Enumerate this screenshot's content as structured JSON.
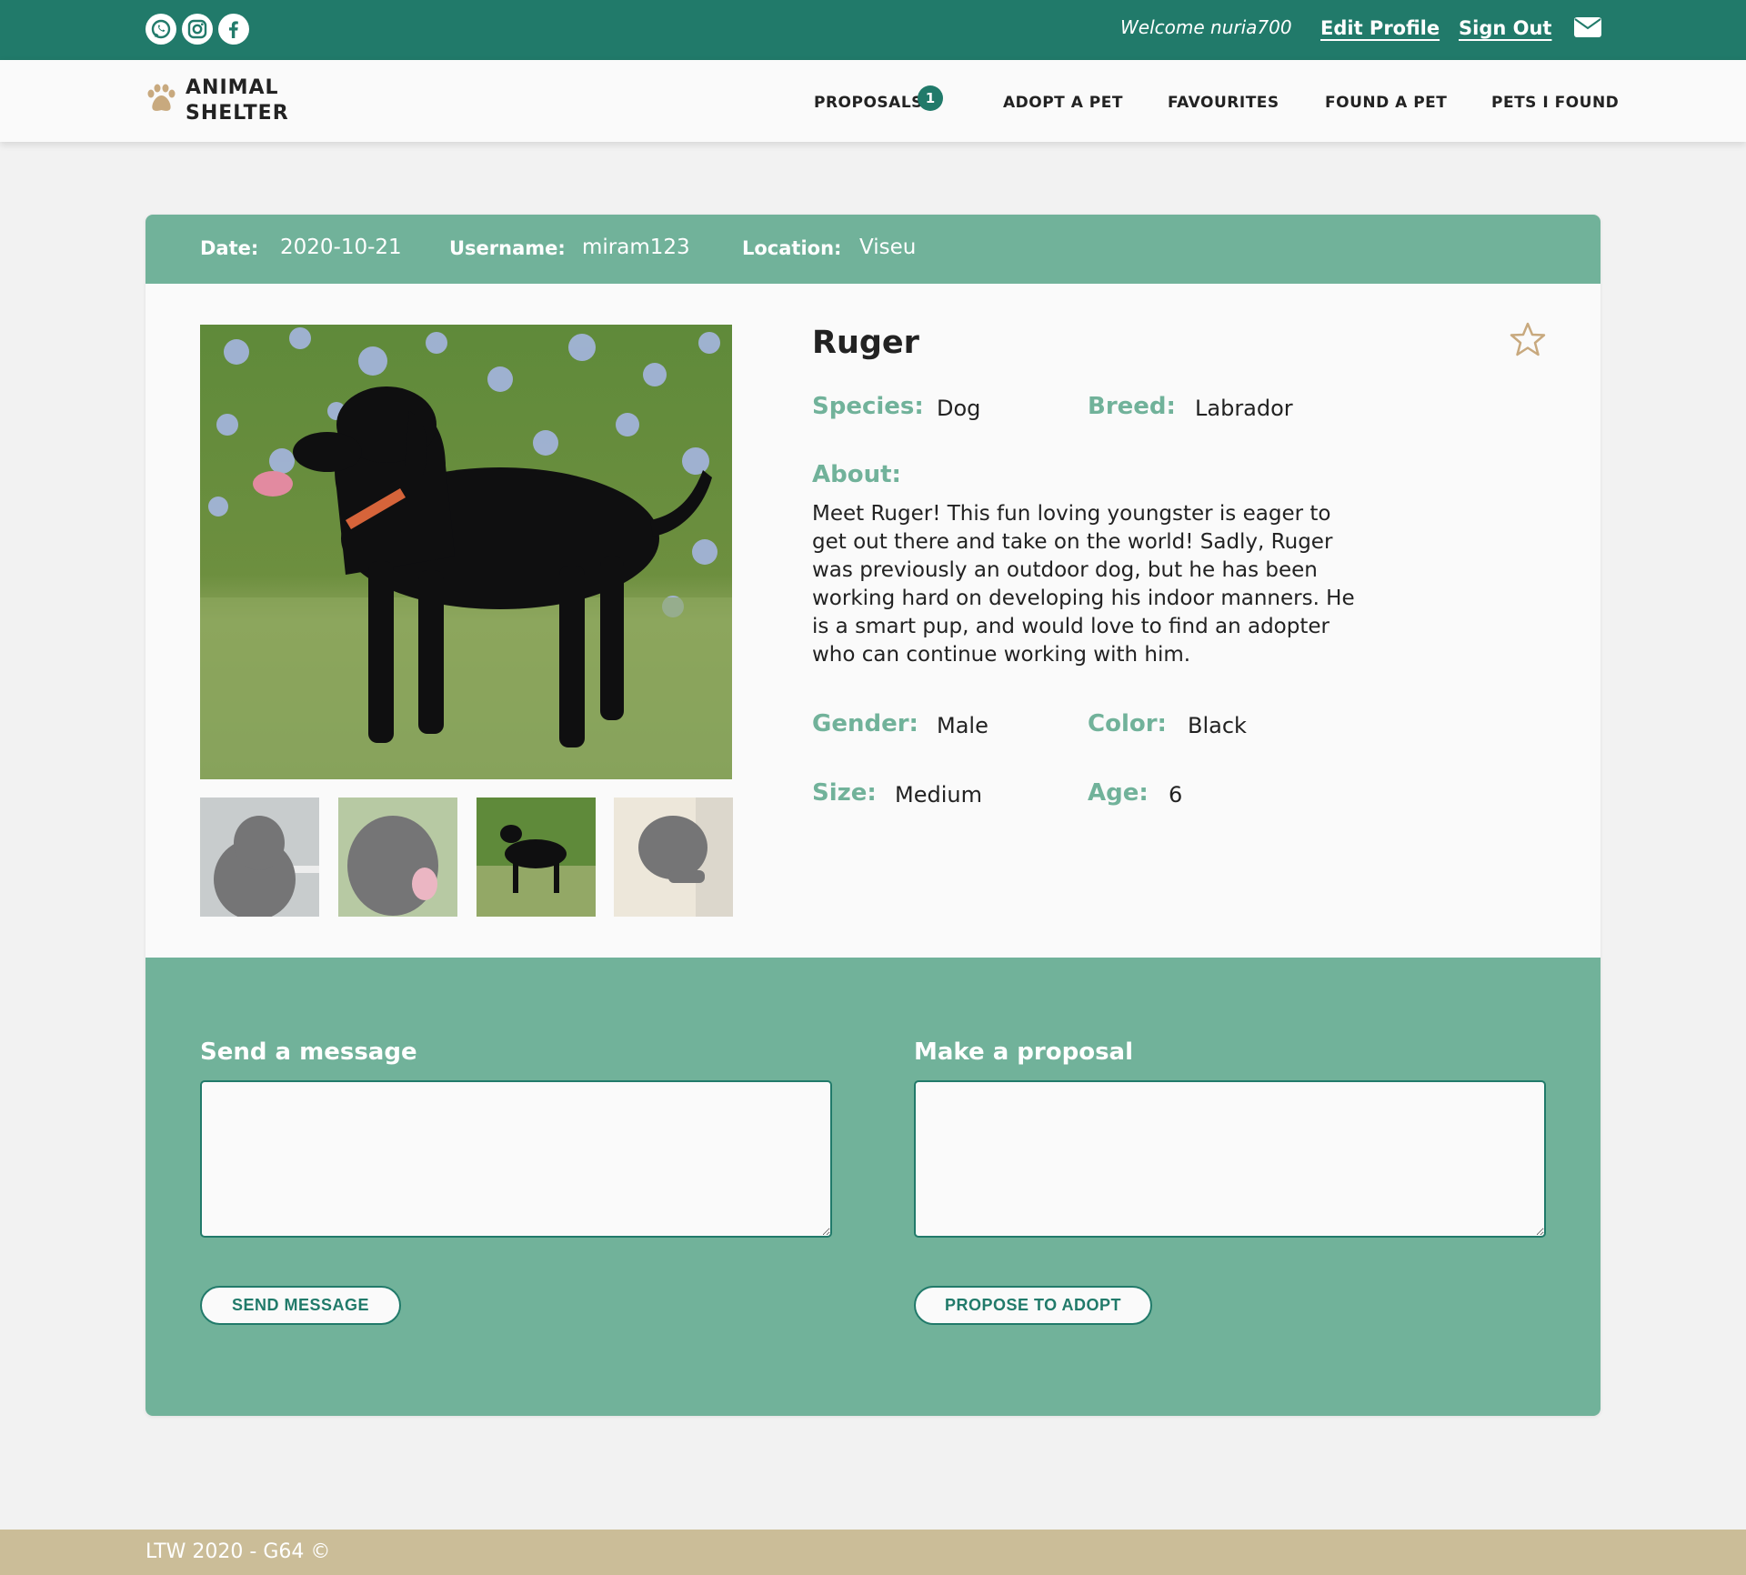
{
  "topbar": {
    "social": [
      "whatsapp-icon",
      "instagram-icon",
      "facebook-icon"
    ],
    "welcome": "Welcome nuria700",
    "edit_profile": "Edit Profile",
    "sign_out": "Sign Out",
    "mail_icon": "envelope-icon"
  },
  "nav": {
    "logo_line1": "ANIMAL",
    "logo_line2": "SHELTER",
    "items": [
      "PROPOSALS",
      "ADOPT A PET",
      "FAVOURITES",
      "FOUND A PET",
      "PETS I FOUND"
    ],
    "proposals_badge": "1"
  },
  "pet_header": {
    "date_label": "Date:",
    "date": "2020-10-21",
    "username_label": "Username:",
    "username": "miram123",
    "location_label": "Location:",
    "location": "Viseu"
  },
  "pet": {
    "name": "Ruger",
    "species_label": "Species:",
    "species": "Dog",
    "breed_label": "Breed:",
    "breed": "Labrador",
    "about_label": "About:",
    "about": "Meet Ruger! This fun loving youngster is eager to get out there and take on the world! Sadly, Ruger was previously an outdoor dog, but he has been working hard on developing his indoor manners. He is a smart pup, and would love to find an adopter who can continue working with him.",
    "gender_label": "Gender:",
    "gender": "Male",
    "color_label": "Color:",
    "color": "Black",
    "size_label": "Size:",
    "size": "Medium",
    "age_label": "Age:",
    "age": "6"
  },
  "actions": {
    "message_title": "Send a message",
    "proposal_title": "Make a proposal",
    "send_button": "SEND MESSAGE",
    "propose_button": "PROPOSE TO ADOPT"
  },
  "footer": {
    "text": "LTW 2020 - G64 ©"
  },
  "colors": {
    "primary": "#217a6a",
    "accent": "#71b29a",
    "sand": "#cbbd98"
  }
}
